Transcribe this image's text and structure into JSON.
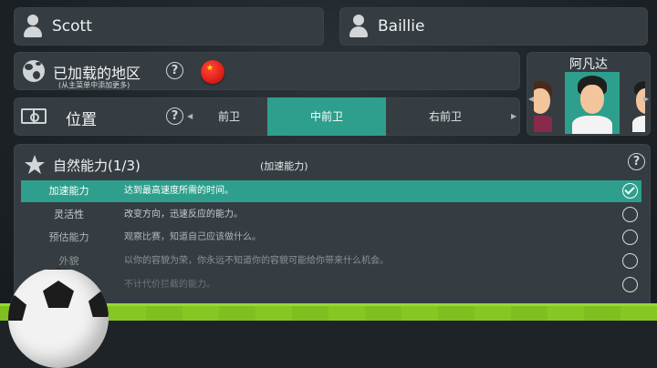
{
  "first_name": "Scott",
  "last_name": "Baillie",
  "region": {
    "title": "已加载的地区",
    "subtitle": "(从主菜单中添加更多)",
    "flag_icon": "china-flag-icon",
    "help": "?"
  },
  "position": {
    "title": "位置",
    "help": "?",
    "options": [
      "左前卫",
      "中前卫",
      "右前卫"
    ],
    "partial_left_label": "前卫",
    "selected": "中前卫",
    "left_arrow": "◀",
    "right_arrow": "▶"
  },
  "portrait": {
    "title": "阿凡达",
    "left_arrow": "◀",
    "right_arrow": "▶"
  },
  "attributes": {
    "title": "自然能力(1/3)",
    "hint": "(加速能力)",
    "help": "?",
    "rows": [
      {
        "name": "加速能力",
        "desc": "达到最高速度所需的时间。",
        "selected": true
      },
      {
        "name": "灵活性",
        "desc": "改变方向，迅速反应的能力。",
        "selected": false
      },
      {
        "name": "预估能力",
        "desc": "观察比赛，知道自己应该做什么。",
        "selected": false
      },
      {
        "name": "外貌",
        "desc": "以你的容貌为荣，你永远不知道你的容貌可能给你带来什么机会。",
        "selected": false
      },
      {
        "name": "",
        "desc": "不计代价拦截的能力。",
        "selected": false
      }
    ]
  },
  "colors": {
    "accent": "#2e9f8c",
    "panel": "#363d42",
    "background": "#1d2327",
    "grass": "#7fbf1f"
  }
}
